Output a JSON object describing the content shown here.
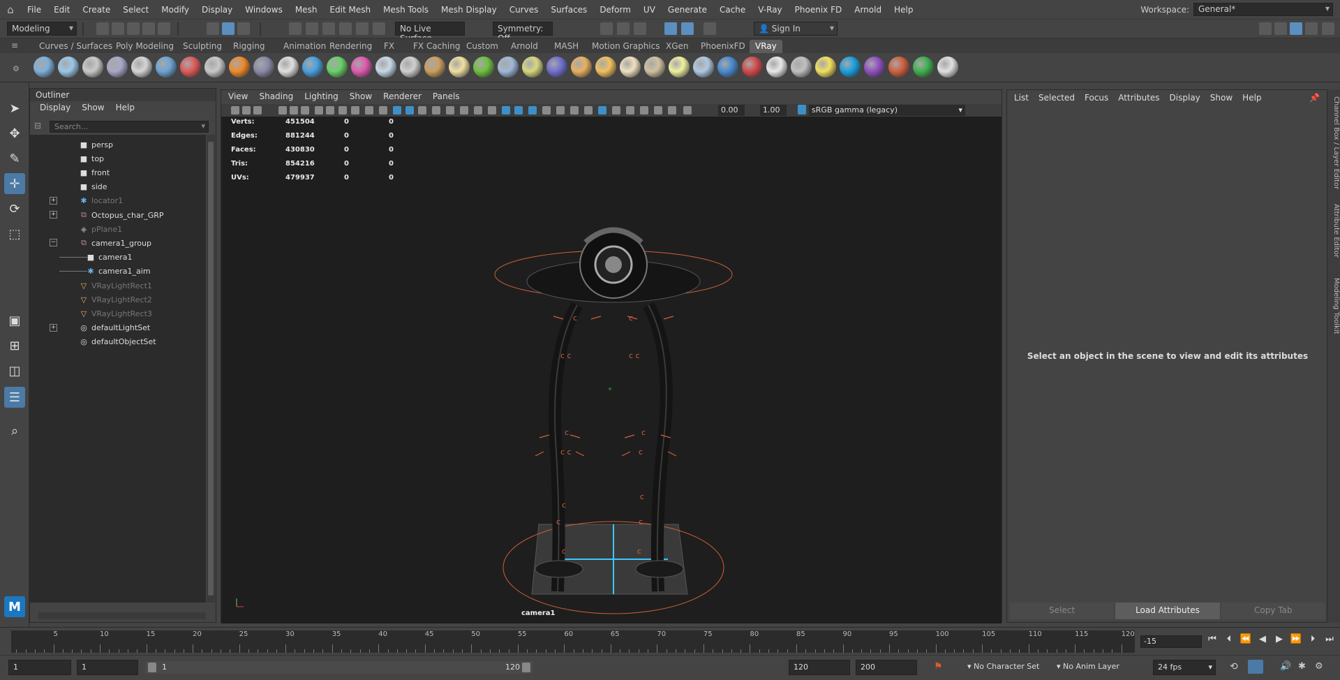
{
  "menubar": {
    "items": [
      "File",
      "Edit",
      "Create",
      "Select",
      "Modify",
      "Display",
      "Windows",
      "Mesh",
      "Edit Mesh",
      "Mesh Tools",
      "Mesh Display",
      "Curves",
      "Surfaces",
      "Deform",
      "UV",
      "Generate",
      "Cache",
      "V-Ray",
      "Phoenix FD",
      "Arnold",
      "Help"
    ],
    "workspace_label": "Workspace:",
    "workspace_value": "General*"
  },
  "statusline": {
    "mode": "Modeling",
    "live_surface": "No Live Surface",
    "symmetry": "Symmetry: Off",
    "sign_in": "Sign In"
  },
  "shelf": {
    "tabs": [
      "Curves / Surfaces",
      "Poly Modeling",
      "Sculpting",
      "Rigging",
      "Animation",
      "Rendering",
      "FX",
      "FX Caching",
      "Custom",
      "Arnold",
      "MASH",
      "Motion Graphics",
      "XGen",
      "PhoenixFD",
      "VRay"
    ],
    "active_tab": "VRay",
    "icon_colors": [
      "#7fb0d8",
      "#9cc7e8",
      "#c9c9c9",
      "#a8a8c8",
      "#d5d5d5",
      "#6ea4d4",
      "#e05a5a",
      "#c8c8c8",
      "#f08a2a",
      "#8a8aa8",
      "#e0e0e0",
      "#4aa0e0",
      "#6ad06a",
      "#e05ab0",
      "#c8d8e8",
      "#d0d0d0",
      "#c9a060",
      "#f0e0a0",
      "#70c040",
      "#a0b8d8",
      "#d8d880",
      "#7070d0",
      "#e8b060",
      "#f0c060",
      "#f0e0c0",
      "#d0c0a0",
      "#f0f0a0",
      "#b0c8e0",
      "#4a8ad0",
      "#d04a4a",
      "#e8e8e8",
      "#c0c0c0",
      "#f0e060",
      "#1aa0e0",
      "#9050c0",
      "#d06040",
      "#40b050",
      "#e0e0e0"
    ]
  },
  "outliner": {
    "title": "Outliner",
    "menu": [
      "Display",
      "Show",
      "Help"
    ],
    "search_placeholder": "Search...",
    "items": [
      {
        "label": "persp",
        "icon": "camera-icon",
        "dim": false,
        "indent": 1,
        "expand": ""
      },
      {
        "label": "top",
        "icon": "camera-icon",
        "dim": false,
        "indent": 1,
        "expand": ""
      },
      {
        "label": "front",
        "icon": "camera-icon",
        "dim": false,
        "indent": 1,
        "expand": ""
      },
      {
        "label": "side",
        "icon": "camera-icon",
        "dim": false,
        "indent": 1,
        "expand": ""
      },
      {
        "label": "locator1",
        "icon": "locator-icon",
        "dim": true,
        "indent": 1,
        "expand": "+"
      },
      {
        "label": "Octopus_char_GRP",
        "icon": "group-icon",
        "dim": false,
        "indent": 1,
        "expand": "+"
      },
      {
        "label": "pPlane1",
        "icon": "mesh-icon",
        "dim": true,
        "indent": 1,
        "expand": ""
      },
      {
        "label": "camera1_group",
        "icon": "group-icon",
        "dim": false,
        "indent": 1,
        "expand": "−"
      },
      {
        "label": "camera1",
        "icon": "camera-icon",
        "dim": false,
        "indent": 2,
        "expand": ""
      },
      {
        "label": "camera1_aim",
        "icon": "locator-icon",
        "dim": false,
        "indent": 2,
        "expand": ""
      },
      {
        "label": "VRayLightRect1",
        "icon": "light-icon",
        "dim": true,
        "indent": 1,
        "expand": ""
      },
      {
        "label": "VRayLightRect2",
        "icon": "light-icon",
        "dim": true,
        "indent": 1,
        "expand": ""
      },
      {
        "label": "VRayLightRect3",
        "icon": "light-icon",
        "dim": true,
        "indent": 1,
        "expand": ""
      },
      {
        "label": "defaultLightSet",
        "icon": "set-icon",
        "dim": false,
        "indent": 1,
        "expand": "+"
      },
      {
        "label": "defaultObjectSet",
        "icon": "set-icon",
        "dim": false,
        "indent": 1,
        "expand": ""
      }
    ]
  },
  "viewport": {
    "menu": [
      "View",
      "Shading",
      "Lighting",
      "Show",
      "Renderer",
      "Panels"
    ],
    "exposure": "0.00",
    "gamma": "1.00",
    "color_space": "sRGB gamma (legacy)",
    "hud": [
      {
        "label": "Verts:",
        "value": "451504",
        "sel": "0",
        "tri": "0"
      },
      {
        "label": "Edges:",
        "value": "881244",
        "sel": "0",
        "tri": "0"
      },
      {
        "label": "Faces:",
        "value": "430830",
        "sel": "0",
        "tri": "0"
      },
      {
        "label": "Tris:",
        "value": "854216",
        "sel": "0",
        "tri": "0"
      },
      {
        "label": "UVs:",
        "value": "479937",
        "sel": "0",
        "tri": "0"
      }
    ],
    "camera_label": "camera1"
  },
  "attribute_editor": {
    "menu": [
      "List",
      "Selected",
      "Focus",
      "Attributes",
      "Display",
      "Show",
      "Help"
    ],
    "message": "Select an object in the scene to view and edit its attributes",
    "buttons": [
      "Select",
      "Load Attributes",
      "Copy Tab"
    ],
    "side_tabs": [
      "Channel Box / Layer Editor",
      "Attribute Editor",
      "Modeling Toolkit"
    ]
  },
  "timeline": {
    "ticks": [
      "5",
      "10",
      "15",
      "20",
      "25",
      "30",
      "35",
      "40",
      "45",
      "50",
      "55",
      "60",
      "65",
      "70",
      "75",
      "80",
      "85",
      "90",
      "95",
      "100",
      "105",
      "110",
      "115",
      "120"
    ],
    "current_frame": "-15"
  },
  "range": {
    "start": "1",
    "playback_start": "1",
    "range_start_label": "1",
    "range_end_label": "120",
    "playback_end": "120",
    "end": "200",
    "character_set": "No Character Set",
    "anim_layer": "No Anim Layer",
    "fps": "24 fps"
  }
}
